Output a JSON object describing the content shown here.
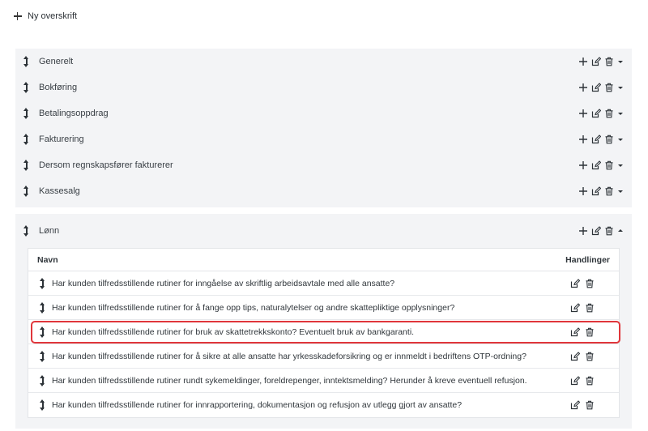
{
  "toolbar": {
    "add_heading_label": "Ny overskrift"
  },
  "sections": [
    {
      "title": "Generelt"
    },
    {
      "title": "Bokføring"
    },
    {
      "title": "Betalingsoppdrag"
    },
    {
      "title": "Fakturering"
    },
    {
      "title": "Dersom regnskapsfører fakturerer"
    },
    {
      "title": "Kassesalg"
    }
  ],
  "expanded_section": {
    "title": "Lønn",
    "columns": {
      "name": "Navn",
      "actions": "Handlinger"
    },
    "rows": [
      {
        "text": "Har kunden tilfredsstillende rutiner for inngåelse av skriftlig arbeidsavtale med alle ansatte?"
      },
      {
        "text": "Har kunden tilfredsstillende rutiner for å fange opp tips, naturalytelser og andre skattepliktige opplysninger?"
      },
      {
        "text": "Har kunden tilfredsstillende rutiner for bruk av skattetrekkskonto? Eventuelt bruk av bankgaranti."
      },
      {
        "text": "Har kunden tilfredsstillende rutiner for å sikre at alle ansatte har yrkesskadeforsikring og er innmeldt i bedriftens OTP-ordning?"
      },
      {
        "text": "Har kunden tilfredsstillende rutiner rundt sykemeldinger, foreldrepenger, inntektsmelding? Herunder å kreve eventuell refusjon."
      },
      {
        "text": "Har kunden tilfredsstillende rutiner for innrapportering, dokumentasjon og refusjon av utlegg gjort av ansatte?"
      }
    ]
  },
  "colors": {
    "panel_bg": "#f3f4f6",
    "highlight": "#e0363b",
    "icon": "#2d3338"
  }
}
